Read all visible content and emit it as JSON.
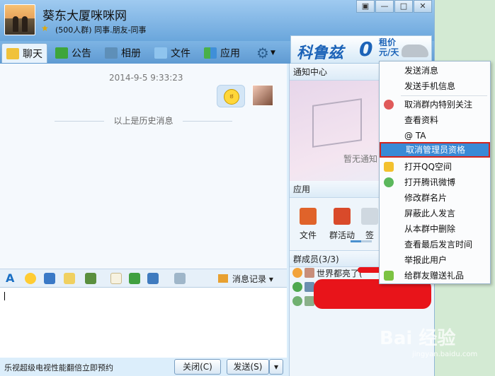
{
  "window": {
    "group_name": "葵东大厦咪咪网",
    "group_sub": "(500人群) 同事.朋友-同事",
    "controls": [
      "▣",
      "—",
      "□",
      "✕"
    ]
  },
  "tabs": [
    {
      "label": "聊天",
      "active": true
    },
    {
      "label": "公告"
    },
    {
      "label": "相册"
    },
    {
      "label": "文件"
    },
    {
      "label": "应用"
    }
  ],
  "ad": {
    "brand": "科鲁兹",
    "zero": "0",
    "price_line1": "租价",
    "price_line2": "元/天"
  },
  "chat": {
    "timestamp": "2014-9-5 9:33:23",
    "history_label": "以上是历史消息"
  },
  "toolbar": {
    "message_log": "消息记录"
  },
  "bottom": {
    "promo": "乐视超级电视性能翻倍立即预约",
    "close_label": "关闭(C)",
    "send_label": "发送(S)"
  },
  "panel": {
    "notify_title": "通知中心",
    "notify_empty": "暂无通知",
    "apps_title": "应用",
    "apps": [
      "文件",
      "群活动",
      "签"
    ],
    "members_title": "群成员(3/3)",
    "members": [
      "世界都亮了("
    ]
  },
  "menu": {
    "items": [
      "发送消息",
      "发送手机信息",
      "取消群内特别关注",
      "查看资料",
      "@ TA",
      "取消管理员资格",
      "打开QQ空间",
      "打开腾讯微博",
      "修改群名片",
      "屏蔽此人发言",
      "从本群中删除",
      "查看最后发言时间",
      "举报此用户",
      "给群友赠送礼品"
    ],
    "selected_index": 5
  },
  "watermark": {
    "text": "Bai 经验",
    "sub": "jingyan.baidu.com"
  }
}
